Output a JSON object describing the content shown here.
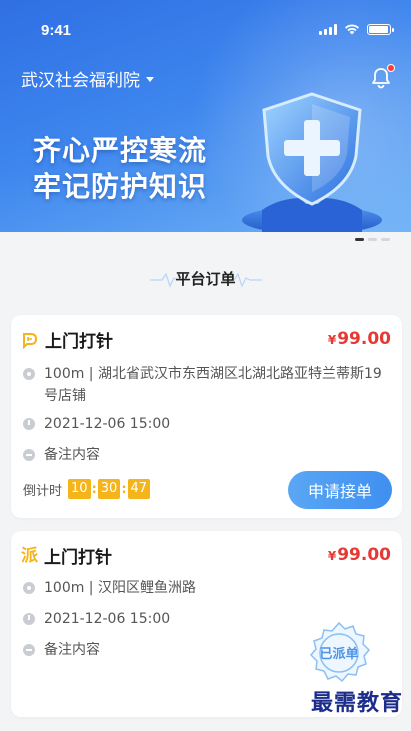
{
  "status_bar": {
    "time": "9:41"
  },
  "header": {
    "org_name": "武汉社会福利院",
    "banner": {
      "line1": "齐心严控寒流",
      "line2": "牢记防护知识"
    }
  },
  "section": {
    "title": "平台订单"
  },
  "orders": [
    {
      "type_icon": "grab-order-icon",
      "title": "上门打针",
      "currency": "¥",
      "price": "99.00",
      "address": "100m | 湖北省武汉市东西湖区北湖北路亚特兰蒂斯19号店铺",
      "time": "2021-12-06 15:00",
      "note": "备注内容",
      "countdown": {
        "label": "倒计时",
        "h": "10",
        "m": "30",
        "s": "47"
      },
      "action_label": "申请接单"
    },
    {
      "type_icon": "dispatch-icon",
      "type_char": "派",
      "title": "上门打针",
      "currency": "¥",
      "price": "99.00",
      "address": "100m | 汉阳区鲤鱼洲路",
      "time": "2021-12-06 15:00",
      "note": "备注内容",
      "stamp": "已派单"
    }
  ],
  "watermark": "最需教育",
  "colors": {
    "accent": "#3f8ff0",
    "price": "#e53935",
    "countdown": "#f4b41a",
    "banner": "#2f6fe3"
  }
}
